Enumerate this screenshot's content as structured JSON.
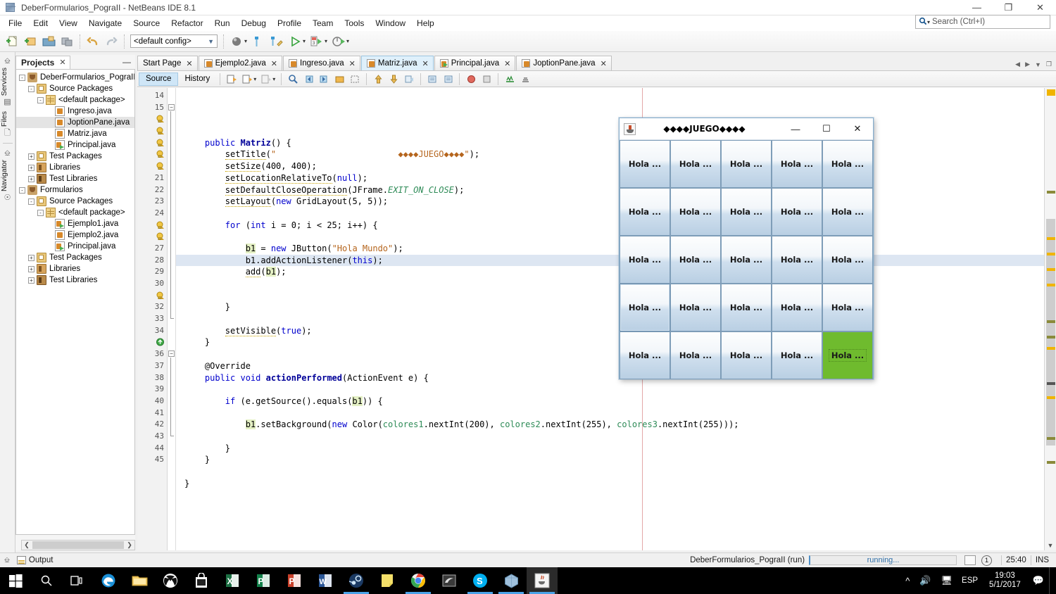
{
  "window": {
    "title": "DeberFormularios_PograII - NetBeans IDE 8.1",
    "app_icon": "netbeans-cube-icon",
    "controls": {
      "minimize": "—",
      "maximize": "❐",
      "close": "✕"
    }
  },
  "menubar": {
    "items": [
      "File",
      "Edit",
      "View",
      "Navigate",
      "Source",
      "Refactor",
      "Run",
      "Debug",
      "Profile",
      "Team",
      "Tools",
      "Window",
      "Help"
    ]
  },
  "search": {
    "placeholder": "Search (Ctrl+I)",
    "icon": "magnifier-icon"
  },
  "toolbar": {
    "config_value": "<default config>",
    "buttons": [
      "new-file",
      "new-project",
      "open-project",
      "save-all",
      "undo",
      "redo",
      "build-project",
      "clean-build",
      "clean-build-alt",
      "run-project",
      "debug-project",
      "profile-project"
    ]
  },
  "rail": {
    "groups": [
      {
        "label": "Services",
        "icon": "services-icon"
      },
      {
        "label": "Files",
        "icon": "files-icon"
      },
      {
        "label": "Navigator",
        "icon": "navigator-compass-icon"
      }
    ]
  },
  "projects_panel": {
    "tab_label": "Projects",
    "close_icon": "✕",
    "minimize_icon": "—",
    "tree": [
      {
        "label": "DeberFormularios_PograII",
        "indent": 0,
        "icon": "project-coffee-icon",
        "expander": "-",
        "selected": false
      },
      {
        "label": "Source Packages",
        "indent": 1,
        "icon": "source-packages-icon",
        "expander": "-",
        "selected": false
      },
      {
        "label": "<default package>",
        "indent": 2,
        "icon": "package-icon",
        "expander": "-",
        "selected": false
      },
      {
        "label": "Ingreso.java",
        "indent": 3,
        "icon": "java-file-icon",
        "expander": "",
        "selected": false
      },
      {
        "label": "JoptionPane.java",
        "indent": 3,
        "icon": "java-file-icon",
        "expander": "",
        "selected": true
      },
      {
        "label": "Matriz.java",
        "indent": 3,
        "icon": "java-file-icon",
        "expander": "",
        "selected": false
      },
      {
        "label": "Principal.java",
        "indent": 3,
        "icon": "java-main-file-icon",
        "expander": "",
        "selected": false
      },
      {
        "label": "Test Packages",
        "indent": 1,
        "icon": "source-packages-icon",
        "expander": "+",
        "selected": false
      },
      {
        "label": "Libraries",
        "indent": 1,
        "icon": "libraries-icon",
        "expander": "+",
        "selected": false
      },
      {
        "label": "Test Libraries",
        "indent": 1,
        "icon": "test-libraries-icon",
        "expander": "+",
        "selected": false
      },
      {
        "label": "Formularios",
        "indent": 0,
        "icon": "project-coffee-icon",
        "expander": "-",
        "selected": false
      },
      {
        "label": "Source Packages",
        "indent": 1,
        "icon": "source-packages-icon",
        "expander": "-",
        "selected": false
      },
      {
        "label": "<default package>",
        "indent": 2,
        "icon": "package-icon",
        "expander": "-",
        "selected": false
      },
      {
        "label": "Ejemplo1.java",
        "indent": 3,
        "icon": "java-main-file-icon",
        "expander": "",
        "selected": false
      },
      {
        "label": "Ejemplo2.java",
        "indent": 3,
        "icon": "java-file-icon",
        "expander": "",
        "selected": false
      },
      {
        "label": "Principal.java",
        "indent": 3,
        "icon": "java-main-file-icon",
        "expander": "",
        "selected": false
      },
      {
        "label": "Test Packages",
        "indent": 1,
        "icon": "source-packages-icon",
        "expander": "+",
        "selected": false
      },
      {
        "label": "Libraries",
        "indent": 1,
        "icon": "libraries-icon",
        "expander": "+",
        "selected": false
      },
      {
        "label": "Test Libraries",
        "indent": 1,
        "icon": "test-libraries-icon",
        "expander": "+",
        "selected": false
      }
    ]
  },
  "editor": {
    "tabs": [
      {
        "label": "Start Page",
        "icon": "",
        "active": false,
        "closable": true
      },
      {
        "label": "Ejemplo2.java",
        "icon": "java-file-icon",
        "active": false,
        "closable": true
      },
      {
        "label": "Ingreso.java",
        "icon": "java-file-icon",
        "active": false,
        "closable": true
      },
      {
        "label": "Matriz.java",
        "icon": "java-file-icon",
        "active": true,
        "closable": true
      },
      {
        "label": "Principal.java",
        "icon": "java-main-file-icon",
        "active": false,
        "closable": true
      },
      {
        "label": "JoptionPane.java",
        "icon": "java-file-icon",
        "active": false,
        "closable": true
      }
    ],
    "tab_nav": [
      "left-arrow-icon",
      "right-arrow-icon",
      "dropdown-list-icon",
      "maximize-window-icon"
    ],
    "modes": {
      "source": "Source",
      "history": "History"
    },
    "tool_icons": [
      "last-edit-icon",
      "back-icon",
      "forward-icon",
      "find-selection-icon",
      "previous-bookmark-icon",
      "next-bookmark-icon",
      "toggle-bookmark-icon",
      "rectangular-selection-icon",
      "shift-left-icon",
      "shift-right-icon",
      "comment-icon",
      "uncomment-icon",
      "toggle-breakpoint-icon",
      "stop-icon",
      "inspect-icon",
      "format-icon"
    ],
    "lines": [
      {
        "n": "14",
        "marker": "",
        "code": []
      },
      {
        "n": "15",
        "marker": "fold-start",
        "code": [
          {
            "t": "    ",
            "c": ""
          },
          {
            "t": "public ",
            "c": "k"
          },
          {
            "t": "Matriz",
            "c": "kw"
          },
          {
            "t": "() {",
            "c": ""
          }
        ]
      },
      {
        "n": "",
        "marker": "warning",
        "code": [
          {
            "t": "        ",
            "c": ""
          },
          {
            "t": "setTitle",
            "c": "uline"
          },
          {
            "t": "(",
            "c": ""
          },
          {
            "t": "\"                        ◆◆◆◆JUEGO◆◆◆◆\"",
            "c": "st"
          },
          {
            "t": ");",
            "c": ""
          }
        ]
      },
      {
        "n": "",
        "marker": "warning",
        "code": [
          {
            "t": "        ",
            "c": ""
          },
          {
            "t": "setSize",
            "c": "uline"
          },
          {
            "t": "(400, 400);",
            "c": ""
          }
        ]
      },
      {
        "n": "",
        "marker": "warning",
        "code": [
          {
            "t": "        ",
            "c": ""
          },
          {
            "t": "setLocationRelativeTo",
            "c": "uline"
          },
          {
            "t": "(",
            "c": ""
          },
          {
            "t": "null",
            "c": "k"
          },
          {
            "t": ");",
            "c": ""
          }
        ]
      },
      {
        "n": "",
        "marker": "warning",
        "code": [
          {
            "t": "        ",
            "c": ""
          },
          {
            "t": "setDefaultCloseOperation",
            "c": "uline"
          },
          {
            "t": "(JFrame.",
            "c": ""
          },
          {
            "t": "EXIT_ON_CLOSE",
            "c": "cst"
          },
          {
            "t": ");",
            "c": ""
          }
        ]
      },
      {
        "n": "",
        "marker": "warning",
        "code": [
          {
            "t": "        ",
            "c": ""
          },
          {
            "t": "setLayout",
            "c": "uline"
          },
          {
            "t": "(",
            "c": ""
          },
          {
            "t": "new",
            "c": "k"
          },
          {
            "t": " GridLayout(5, 5));",
            "c": ""
          }
        ]
      },
      {
        "n": "21",
        "marker": "",
        "code": []
      },
      {
        "n": "22",
        "marker": "",
        "code": [
          {
            "t": "        ",
            "c": ""
          },
          {
            "t": "for",
            "c": "k"
          },
          {
            "t": " (",
            "c": ""
          },
          {
            "t": "int",
            "c": "k"
          },
          {
            "t": " i = 0; i < 25; i++) {",
            "c": ""
          }
        ]
      },
      {
        "n": "23",
        "marker": "",
        "code": []
      },
      {
        "n": "24",
        "marker": "",
        "code": [
          {
            "t": "            ",
            "c": ""
          },
          {
            "t": "b1",
            "c": "hlv"
          },
          {
            "t": " = ",
            "c": ""
          },
          {
            "t": "new",
            "c": "k"
          },
          {
            "t": " JButton(",
            "c": ""
          },
          {
            "t": "\"Hola Mundo\"",
            "c": "st"
          },
          {
            "t": ");",
            "c": ""
          }
        ]
      },
      {
        "n": "",
        "marker": "warning",
        "highlight": true,
        "code": [
          {
            "t": "            ",
            "c": ""
          },
          {
            "t": "b1",
            "c": ""
          },
          {
            "t": ".addActionListener(",
            "c": ""
          },
          {
            "t": "this",
            "c": "k"
          },
          {
            "t": ");",
            "c": ""
          }
        ]
      },
      {
        "n": "",
        "marker": "warning",
        "code": [
          {
            "t": "            ",
            "c": ""
          },
          {
            "t": "add",
            "c": "uline"
          },
          {
            "t": "(",
            "c": ""
          },
          {
            "t": "b1",
            "c": "hlv"
          },
          {
            "t": ");",
            "c": ""
          }
        ]
      },
      {
        "n": "27",
        "marker": "",
        "code": []
      },
      {
        "n": "28",
        "marker": "",
        "code": []
      },
      {
        "n": "29",
        "marker": "",
        "code": [
          {
            "t": "        }",
            "c": ""
          }
        ]
      },
      {
        "n": "30",
        "marker": "",
        "code": []
      },
      {
        "n": "",
        "marker": "warning",
        "code": [
          {
            "t": "        ",
            "c": ""
          },
          {
            "t": "setVisible",
            "c": "uline"
          },
          {
            "t": "(",
            "c": ""
          },
          {
            "t": "true",
            "c": "k"
          },
          {
            "t": ");",
            "c": ""
          }
        ]
      },
      {
        "n": "32",
        "marker": "fold-end",
        "code": [
          {
            "t": "    }",
            "c": ""
          }
        ]
      },
      {
        "n": "33",
        "marker": "",
        "code": []
      },
      {
        "n": "34",
        "marker": "",
        "code": [
          {
            "t": "    @Override",
            "c": ""
          }
        ]
      },
      {
        "n": "",
        "marker": "override",
        "code": [
          {
            "t": "    ",
            "c": ""
          },
          {
            "t": "public void",
            "c": "k"
          },
          {
            "t": " ",
            "c": ""
          },
          {
            "t": "actionPerformed",
            "c": "kw"
          },
          {
            "t": "(ActionEvent e) {",
            "c": ""
          }
        ]
      },
      {
        "n": "36",
        "marker": "",
        "code": []
      },
      {
        "n": "37",
        "marker": "",
        "code": [
          {
            "t": "        ",
            "c": ""
          },
          {
            "t": "if",
            "c": "k"
          },
          {
            "t": " (e.getSource().equals(",
            "c": ""
          },
          {
            "t": "b1",
            "c": "hlv"
          },
          {
            "t": ")) {",
            "c": ""
          }
        ]
      },
      {
        "n": "38",
        "marker": "",
        "code": []
      },
      {
        "n": "39",
        "marker": "",
        "code": [
          {
            "t": "            ",
            "c": ""
          },
          {
            "t": "b1",
            "c": "hlv"
          },
          {
            "t": ".setBackground(",
            "c": ""
          },
          {
            "t": "new",
            "c": "k"
          },
          {
            "t": " Color(",
            "c": ""
          },
          {
            "t": "colores1",
            "c": "gr"
          },
          {
            "t": ".nextInt(200), ",
            "c": ""
          },
          {
            "t": "colores2",
            "c": "gr"
          },
          {
            "t": ".nextInt(255), ",
            "c": ""
          },
          {
            "t": "colores3",
            "c": "gr"
          },
          {
            "t": ".nextInt(255)));",
            "c": ""
          }
        ]
      },
      {
        "n": "40",
        "marker": "",
        "code": []
      },
      {
        "n": "41",
        "marker": "",
        "code": [
          {
            "t": "        }",
            "c": ""
          }
        ]
      },
      {
        "n": "42",
        "marker": "fold-end2",
        "code": [
          {
            "t": "    }",
            "c": ""
          }
        ]
      },
      {
        "n": "43",
        "marker": "",
        "code": []
      },
      {
        "n": "44",
        "marker": "",
        "code": [
          {
            "t": "}",
            "c": ""
          }
        ]
      },
      {
        "n": "45",
        "marker": "",
        "code": []
      }
    ]
  },
  "java_window": {
    "title": "◆◆◆◆JUEGO◆◆◆◆",
    "icon": "java-coffee-cup-icon",
    "controls": {
      "minimize": "—",
      "maximize": "☐",
      "close": "✕"
    },
    "grid": {
      "rows": 5,
      "cols": 5,
      "button_label": "Hola ...",
      "focused_index": 15,
      "green_index": 24,
      "green_color": "#6fbb2e"
    }
  },
  "statusbar": {
    "output_label": "Output",
    "output_icon": "output-window-icon",
    "run_task": "DeberFormularios_PograII (run)",
    "progress_text": "running...",
    "progress_color": "#2f6fa8",
    "notification_count": "1",
    "cursor_position": "25:40",
    "insert_mode": "INS"
  },
  "taskbar": {
    "items": [
      {
        "name": "start-button-icon"
      },
      {
        "name": "search-icon"
      },
      {
        "name": "task-view-icon"
      },
      {
        "name": "edge-icon"
      },
      {
        "name": "file-explorer-icon"
      },
      {
        "name": "xbox-icon"
      },
      {
        "name": "microsoft-store-icon"
      },
      {
        "name": "excel-icon"
      },
      {
        "name": "publisher-icon"
      },
      {
        "name": "powerpoint-icon"
      },
      {
        "name": "word-icon"
      },
      {
        "name": "steam-icon"
      },
      {
        "name": "sticky-notes-icon"
      },
      {
        "name": "chrome-icon"
      },
      {
        "name": "nvidia-icon"
      },
      {
        "name": "skype-icon"
      },
      {
        "name": "netbeans-icon"
      },
      {
        "name": "java-app-icon"
      }
    ],
    "tray": {
      "chevron": "show-hidden-icons",
      "volume": "volume-icon",
      "network": "network-icon",
      "language": "ESP",
      "time": "19:03",
      "date": "5/1/2017",
      "action_center": "action-center-icon"
    }
  }
}
